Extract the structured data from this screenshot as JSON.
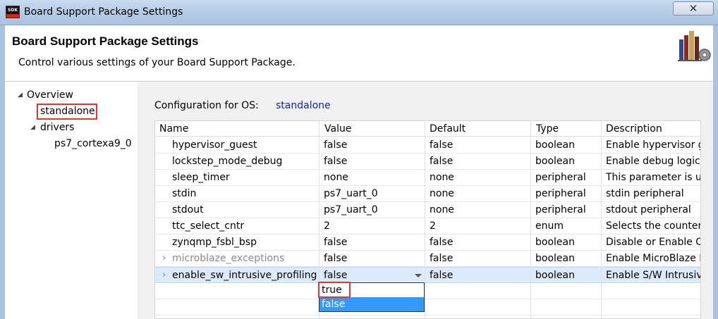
{
  "window": {
    "title": "Board Support Package Settings",
    "close_glyph": "✕",
    "app_icon_text": "SDK"
  },
  "header": {
    "title": "Board Support Package Settings",
    "subtitle": "Control various settings of your Board Support Package."
  },
  "tree": {
    "overview": "Overview",
    "standalone": "standalone",
    "drivers": "drivers",
    "cpu_driver": "ps7_cortexa9_0"
  },
  "config": {
    "label": "Configuration for OS:",
    "os": "standalone"
  },
  "table": {
    "columns": [
      "Name",
      "Value",
      "Default",
      "Type",
      "Description"
    ],
    "rows": [
      {
        "name": "hypervisor_guest",
        "value": "false",
        "default": "false",
        "type": "boolean",
        "description": "Enable hypervisor gu"
      },
      {
        "name": "lockstep_mode_debug",
        "value": "false",
        "default": "false",
        "type": "boolean",
        "description": "Enable debug logic i"
      },
      {
        "name": "sleep_timer",
        "value": "none",
        "default": "none",
        "type": "peripheral",
        "description": "This parameter is use"
      },
      {
        "name": "stdin",
        "value": "ps7_uart_0",
        "default": "none",
        "type": "peripheral",
        "description": "stdin peripheral"
      },
      {
        "name": "stdout",
        "value": "ps7_uart_0",
        "default": "none",
        "type": "peripheral",
        "description": "stdout peripheral"
      },
      {
        "name": "ttc_select_cntr",
        "value": "2",
        "default": "2",
        "type": "enum",
        "description": "Selects the counter to"
      },
      {
        "name": "zynqmp_fsbl_bsp",
        "value": "false",
        "default": "false",
        "type": "boolean",
        "description": "Disable or Enable Op"
      },
      {
        "name": "microblaze_exceptions",
        "value": "false",
        "default": "false",
        "type": "boolean",
        "description": "Enable MicroBlaze E"
      },
      {
        "name": "enable_sw_intrusive_profiling",
        "value": "false",
        "default": "false",
        "type": "boolean",
        "description": "Enable S/W Intrusive"
      }
    ]
  },
  "dropdown": {
    "options": [
      "true",
      "false"
    ],
    "selected": "false"
  },
  "colors": {
    "highlight_box": "#d9383a",
    "link_blue": "#1a20b0",
    "selection_blue": "#3399ff"
  }
}
